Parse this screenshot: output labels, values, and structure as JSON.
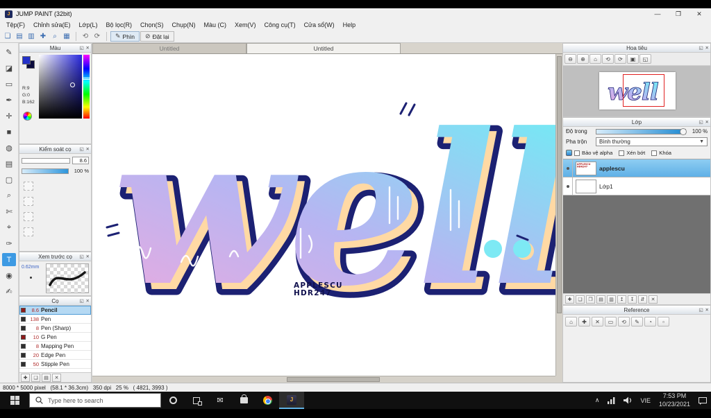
{
  "ui": {
    "undock": "◱",
    "close": "✕"
  },
  "window": {
    "title": "JUMP PAINT (32bit)",
    "minimize": "—",
    "maximize": "❐",
    "close": "✕"
  },
  "menu": {
    "items": [
      "Tệp(F)",
      "Chỉnh sửa(E)",
      "Lớp(L)",
      "Bộ lọc(R)",
      "Chọn(S)",
      "Chụp(N)",
      "Màu (C)",
      "Xem(V)",
      "Công cụ(T)",
      "Cửa sổ(W)",
      "Help"
    ]
  },
  "toolbar": {
    "file_icons": [
      "❏",
      "▤",
      "▥",
      "✚",
      "⌕",
      "▦"
    ],
    "history_icons": [
      "⟲",
      "⟳"
    ],
    "pen_icon": "✎",
    "pen_label": "Phìn",
    "reset_icon": "⊘",
    "reset_label": "Đặt lại"
  },
  "tools": {
    "items": [
      "✎",
      "◪",
      "▭",
      "✒",
      "✛",
      "■",
      "◍",
      "▤",
      "▢",
      "⌕",
      "✄",
      "⌖",
      "✑",
      "T",
      "◉",
      "✍"
    ]
  },
  "panels": {
    "color": {
      "title": "Màu",
      "r": "R:9",
      "g": "G:0",
      "b": "B:162"
    },
    "brush_control": {
      "title": "Kiểm soát cọ",
      "size": "8.6",
      "opacity": "100 %"
    },
    "brush_preview": {
      "title": "Xem trước cọ",
      "size": "0.62mm"
    },
    "brushes": {
      "title": "Cọ",
      "items": [
        {
          "size": "8.6",
          "name": "Pencil"
        },
        {
          "size": "138",
          "name": "Pen"
        },
        {
          "size": "8",
          "name": "Pen (Sharp)"
        },
        {
          "size": "10",
          "name": "G Pen"
        },
        {
          "size": "8",
          "name": "Mapping Pen"
        },
        {
          "size": "20",
          "name": "Edge Pen"
        },
        {
          "size": "50",
          "name": "Stipple Pen"
        }
      ],
      "footer_icons": [
        "✚",
        "❏",
        "▤",
        "✕"
      ]
    }
  },
  "canvas": {
    "tabs": [
      "Untitled",
      "Untitled"
    ]
  },
  "artwork": {
    "word": "well",
    "credit_line1": "APPLESCU",
    "credit_line2": "HDR247",
    "gradient": [
      "#f0a9dd",
      "#b7b5f2",
      "#77e7f4"
    ],
    "outline": "#1c2173",
    "shadow": "#ffd9a4",
    "dot_color": "#7de9f4"
  },
  "navigator": {
    "title": "Hoa tiêu",
    "zoom_icons": [
      "⊖",
      "⊕",
      "⌂",
      "⟲",
      "⟳",
      "▣",
      "◱"
    ]
  },
  "layers": {
    "title": "Lớp",
    "opacity_label": "Độ trong",
    "opacity_value": "100 %",
    "blend_label": "Pha trộn",
    "blend_value": "Bình thường",
    "checks": [
      "Bảo vệ alpha",
      "Xén bớt",
      "Khóa"
    ],
    "items": [
      {
        "name": "applescu"
      },
      {
        "name": "Lớp1"
      }
    ],
    "toolbar_icons": [
      "✚",
      "❏",
      "❐",
      "▤",
      "▥",
      "↥",
      "↧",
      "⇵",
      "✕"
    ]
  },
  "reference": {
    "title": "Reference",
    "icons": [
      "⌂",
      "✚",
      "✕",
      "▭",
      "⟲",
      "✎",
      "◔",
      "▫"
    ]
  },
  "statusbar": {
    "info": "8000 * 5000 pixel   (58.1 * 36.3cm)   350 dpi   25 %   ( 4821, 3993 )"
  },
  "taskbar": {
    "search_placeholder": "Type here to search",
    "language": "VIE",
    "time": "7:53 PM",
    "date": "10/23/2021"
  }
}
